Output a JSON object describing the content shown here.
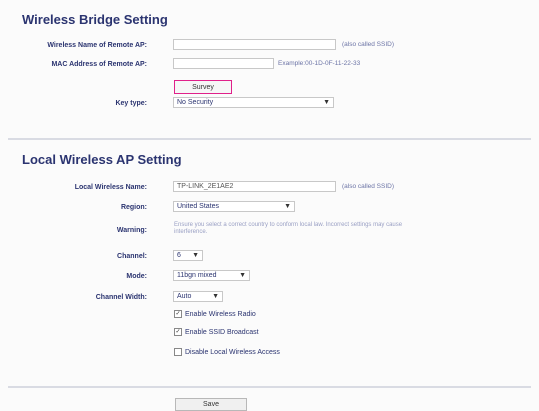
{
  "bridge": {
    "title": "Wireless Bridge Setting",
    "ssid_label": "Wireless Name of Remote AP:",
    "ssid_value": "",
    "ssid_note": "(also called SSID)",
    "mac_label": "MAC Address of Remote AP:",
    "mac_value": "",
    "mac_note": "Example:00-1D-0F-11-22-33",
    "survey_button": "Survey",
    "keytype_label": "Key type:",
    "keytype_value": "No Security"
  },
  "local": {
    "title": "Local Wireless AP Setting",
    "name_label": "Local Wireless Name:",
    "name_value": "TP-LINK_2E1AE2",
    "name_note": "(also called SSID)",
    "region_label": "Region:",
    "region_value": "United States",
    "warning_label": "Warning:",
    "warning_text": "Ensure you select a correct country to conform local law. Incorrect settings may cause interference.",
    "channel_label": "Channel:",
    "channel_value": "6",
    "mode_label": "Mode:",
    "mode_value": "11bgn mixed",
    "width_label": "Channel Width:",
    "width_value": "Auto",
    "checkboxes": [
      {
        "label": "Enable Wireless Radio",
        "checked": true
      },
      {
        "label": "Enable SSID Broadcast",
        "checked": true
      },
      {
        "label": "Disable Local Wireless Access",
        "checked": false
      }
    ]
  },
  "footer": {
    "save_button": "Save"
  },
  "colors": {
    "label": "#2b3470",
    "highlight": "#e0208a"
  }
}
